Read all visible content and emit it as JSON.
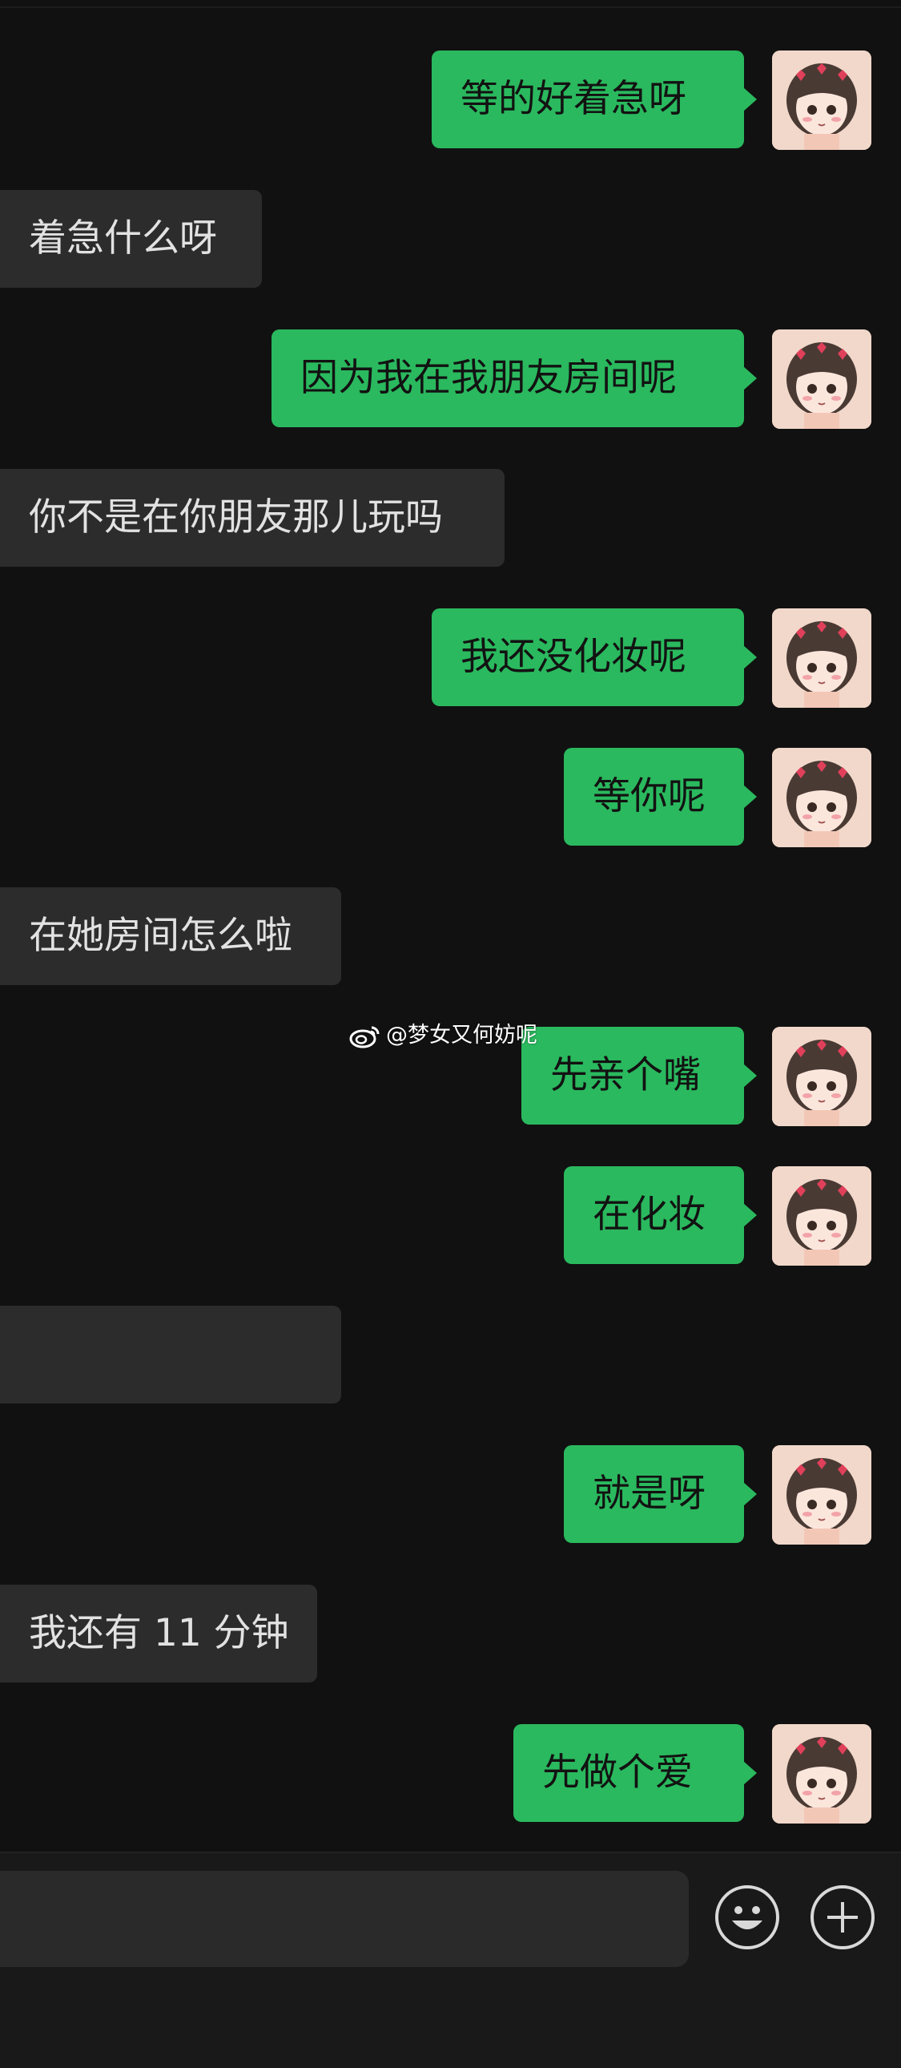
{
  "watermark": {
    "text": "@梦女又何妨呢",
    "icon": "weibo-icon"
  },
  "messages": [
    {
      "side": "right",
      "text": "等的好着急呀"
    },
    {
      "side": "left",
      "text": "着急什么呀"
    },
    {
      "side": "right",
      "text": "因为我在我朋友房间呢"
    },
    {
      "side": "left",
      "text": "你不是在你朋友那儿玩吗"
    },
    {
      "side": "right",
      "text": "我还没化妆呢"
    },
    {
      "side": "right",
      "text": "等你呢"
    },
    {
      "side": "left",
      "text": "在她房间怎么啦"
    },
    {
      "side": "right",
      "text": "先亲个嘴"
    },
    {
      "side": "right",
      "text": "在化妆"
    },
    {
      "side": "left",
      "text": "",
      "blurred": true
    },
    {
      "side": "right",
      "text": "就是呀"
    },
    {
      "side": "left",
      "text": "我还有 11 分钟"
    },
    {
      "side": "right",
      "text": "先做个爱"
    }
  ],
  "input_bar": {
    "emoji_icon": "smile-emoji-icon",
    "plus_icon": "plus-circle-icon"
  },
  "colors": {
    "background": "#111111",
    "outgoing_bubble": "#2ab95e",
    "incoming_bubble": "#2c2c2c"
  }
}
